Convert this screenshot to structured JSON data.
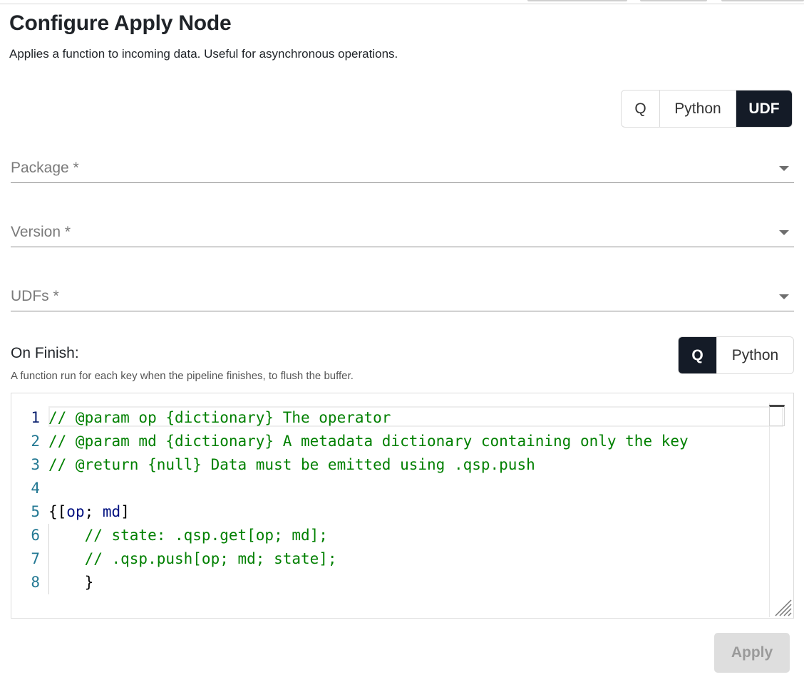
{
  "header": {
    "title": "Configure Apply Node",
    "subtitle": "Applies a function to incoming data. Useful for asynchronous operations."
  },
  "language_toggle": {
    "options": [
      "Q",
      "Python",
      "UDF"
    ],
    "selected": "UDF"
  },
  "fields": {
    "package": "Package *",
    "version": "Version *",
    "udfs": "UDFs *"
  },
  "on_finish": {
    "label": "On Finish:",
    "hint": "A function run for each key when the pipeline finishes, to flush the buffer.",
    "toggle": {
      "options": [
        "Q",
        "Python"
      ],
      "selected": "Q"
    }
  },
  "editor": {
    "line_numbers": [
      "1",
      "2",
      "3",
      "4",
      "5",
      "6",
      "7",
      "8"
    ],
    "lines": [
      [
        {
          "t": "// @param op {dictionary} The operator",
          "c": "cmt"
        }
      ],
      [
        {
          "t": "// @param md {dictionary} A metadata dictionary containing only the key",
          "c": "cmt"
        }
      ],
      [
        {
          "t": "// @return {null} Data must be emitted using .qsp.push",
          "c": "cmt"
        }
      ],
      [],
      [
        {
          "t": "{[",
          "c": "plain"
        },
        {
          "t": "op",
          "c": "ident"
        },
        {
          "t": "; ",
          "c": "plain"
        },
        {
          "t": "md",
          "c": "ident"
        },
        {
          "t": "]",
          "c": "plain"
        }
      ],
      [
        {
          "t": "    // state: .qsp.get[op; md];",
          "c": "cmt"
        }
      ],
      [
        {
          "t": "    // .qsp.push[op; md; state];",
          "c": "cmt"
        }
      ],
      [
        {
          "t": "    }",
          "c": "plain"
        }
      ]
    ]
  },
  "footer": {
    "apply_label": "Apply"
  },
  "colors": {
    "accent_dark": "#141b27",
    "comment": "#008000",
    "identifier": "#001080",
    "line_number": "#237893",
    "disabled_button": "#dedede"
  }
}
